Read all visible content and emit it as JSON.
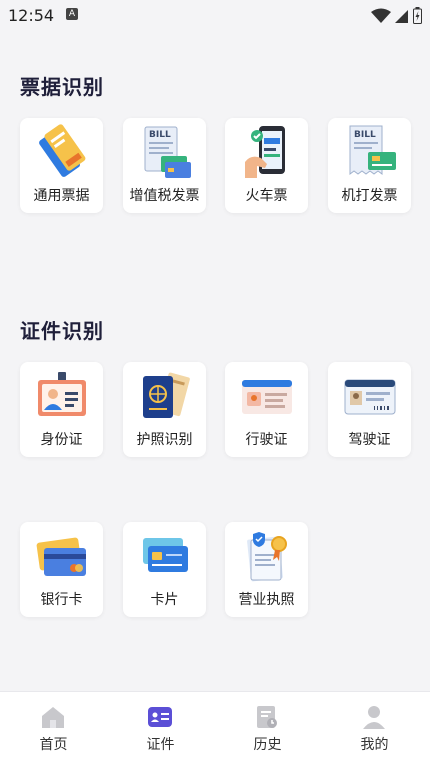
{
  "status": {
    "time": "12:54",
    "indicator": "A"
  },
  "sections": [
    {
      "title": "票据识别",
      "items": [
        {
          "label": "通用票据",
          "icon": "ticket-icon"
        },
        {
          "label": "增值税发票",
          "icon": "vat-invoice-icon"
        },
        {
          "label": "火车票",
          "icon": "train-ticket-icon"
        },
        {
          "label": "机打发票",
          "icon": "machine-invoice-icon"
        }
      ]
    },
    {
      "title": "证件识别",
      "items": [
        {
          "label": "身份证",
          "icon": "id-card-icon"
        },
        {
          "label": "护照识别",
          "icon": "passport-icon"
        },
        {
          "label": "行驶证",
          "icon": "vehicle-license-icon"
        },
        {
          "label": "驾驶证",
          "icon": "driver-license-icon"
        },
        {
          "label": "银行卡",
          "icon": "bank-card-icon"
        },
        {
          "label": "卡片",
          "icon": "card-icon"
        },
        {
          "label": "营业执照",
          "icon": "business-license-icon"
        }
      ]
    }
  ],
  "tabs": [
    {
      "label": "首页",
      "icon": "home-icon",
      "active": false
    },
    {
      "label": "证件",
      "icon": "id-badge-icon",
      "active": true
    },
    {
      "label": "历史",
      "icon": "history-icon",
      "active": false
    },
    {
      "label": "我的",
      "icon": "user-icon",
      "active": false
    }
  ],
  "colors": {
    "accent": "#5b4fd6",
    "inactive": "#c8c8cc"
  }
}
